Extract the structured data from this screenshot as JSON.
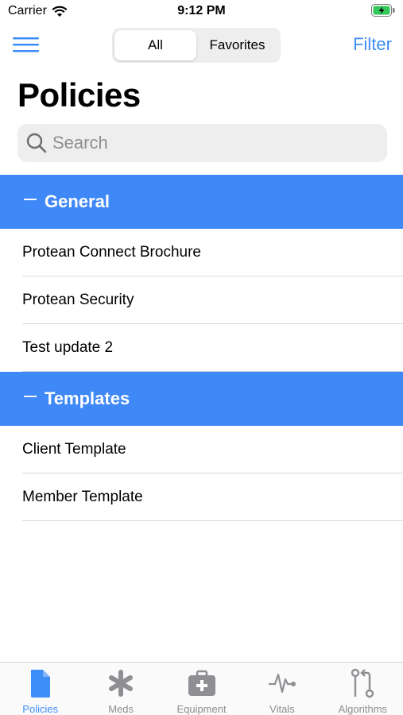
{
  "status_bar": {
    "carrier": "Carrier",
    "time": "9:12 PM"
  },
  "nav": {
    "segments": [
      "All",
      "Favorites"
    ],
    "selected_segment": "All",
    "filter_label": "Filter"
  },
  "page_title": "Policies",
  "search": {
    "placeholder": "Search",
    "value": ""
  },
  "sections": [
    {
      "title": "General",
      "items": [
        "Protean Connect Brochure",
        "Protean Security",
        "Test update 2"
      ]
    },
    {
      "title": "Templates",
      "items": [
        "Client Template",
        "Member Template"
      ]
    }
  ],
  "tabs": [
    {
      "label": "Policies",
      "icon": "document-icon",
      "active": true
    },
    {
      "label": "Meds",
      "icon": "asterisk-icon",
      "active": false
    },
    {
      "label": "Equipment",
      "icon": "first-aid-kit-icon",
      "active": false
    },
    {
      "label": "Vitals",
      "icon": "pulse-icon",
      "active": false
    },
    {
      "label": "Algorithms",
      "icon": "flow-icon",
      "active": false
    }
  ],
  "colors": {
    "accent": "#3e8ef7",
    "section_header": "#3f88f7",
    "inactive": "#8e8e93"
  }
}
